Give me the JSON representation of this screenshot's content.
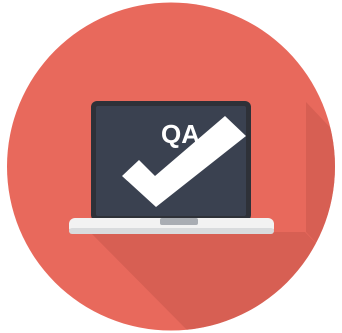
{
  "icon": {
    "name": "qa-laptop-checkmark-icon",
    "label": "QA",
    "colors": {
      "circle": "#E8695C",
      "shadow": "#C9574C",
      "screen_bezel": "#2E3138",
      "screen": "#3A4150",
      "base": "#F2F2F2",
      "base_bottom": "#D9DBDD",
      "notch": "#A9ADB3",
      "foreground": "#FFFFFF"
    }
  }
}
